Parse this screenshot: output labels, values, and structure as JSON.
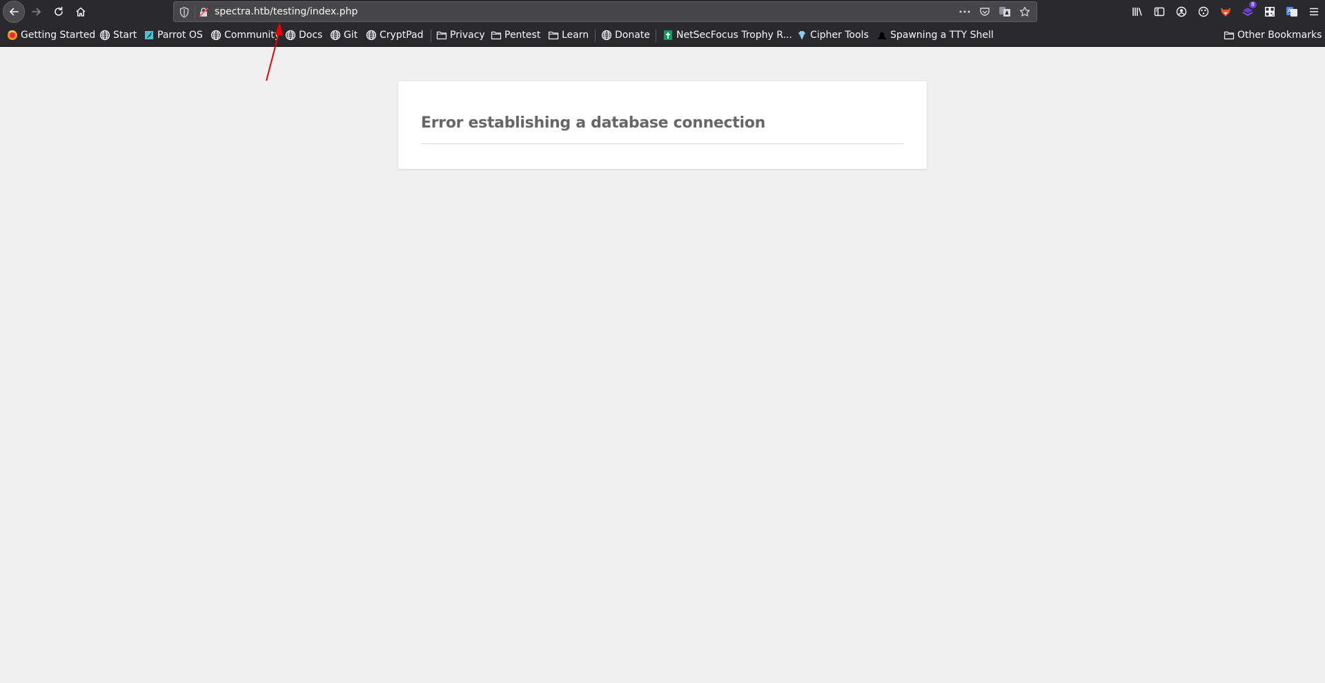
{
  "browser": {
    "url": "spectra.htb/testing/index.php",
    "toolbar_icons": [
      "back-icon",
      "forward-icon",
      "reload-icon",
      "home-icon"
    ],
    "right_icons": [
      "library-icon",
      "sidebar-icon",
      "account-icon",
      "extensions-icon",
      "foxyproxy-icon",
      "wappalyzer-icon",
      "qr-code-icon",
      "translate-icon",
      "menu-icon"
    ],
    "extension_badge": "8"
  },
  "bookmarks": {
    "items": [
      {
        "label": "Getting Started",
        "icon": "firefox-icon"
      },
      {
        "label": "Start",
        "icon": "globe-icon"
      },
      {
        "label": "Parrot OS",
        "icon": "parrot-icon"
      },
      {
        "label": "Community",
        "icon": "globe-icon"
      },
      {
        "label": "Docs",
        "icon": "globe-icon"
      },
      {
        "label": "Git",
        "icon": "globe-icon"
      },
      {
        "label": "CryptPad",
        "icon": "globe-icon"
      },
      {
        "label": "Privacy",
        "icon": "folder-icon"
      },
      {
        "label": "Pentest",
        "icon": "folder-icon"
      },
      {
        "label": "Learn",
        "icon": "folder-icon"
      },
      {
        "label": "Donate",
        "icon": "globe-icon"
      },
      {
        "label": "NetSecFocus Trophy R...",
        "icon": "sheet-icon"
      },
      {
        "label": "Cipher Tools",
        "icon": "gem-icon"
      },
      {
        "label": "Spawning a TTY Shell",
        "icon": "hat-icon"
      }
    ],
    "other": "Other Bookmarks"
  },
  "page": {
    "error_message": "Error establishing a database connection"
  },
  "colors": {
    "chrome": "#2a2a2e",
    "urlbar": "#474749",
    "page_bg": "#f0f0f0",
    "annotation_arrow": "#e60000"
  }
}
